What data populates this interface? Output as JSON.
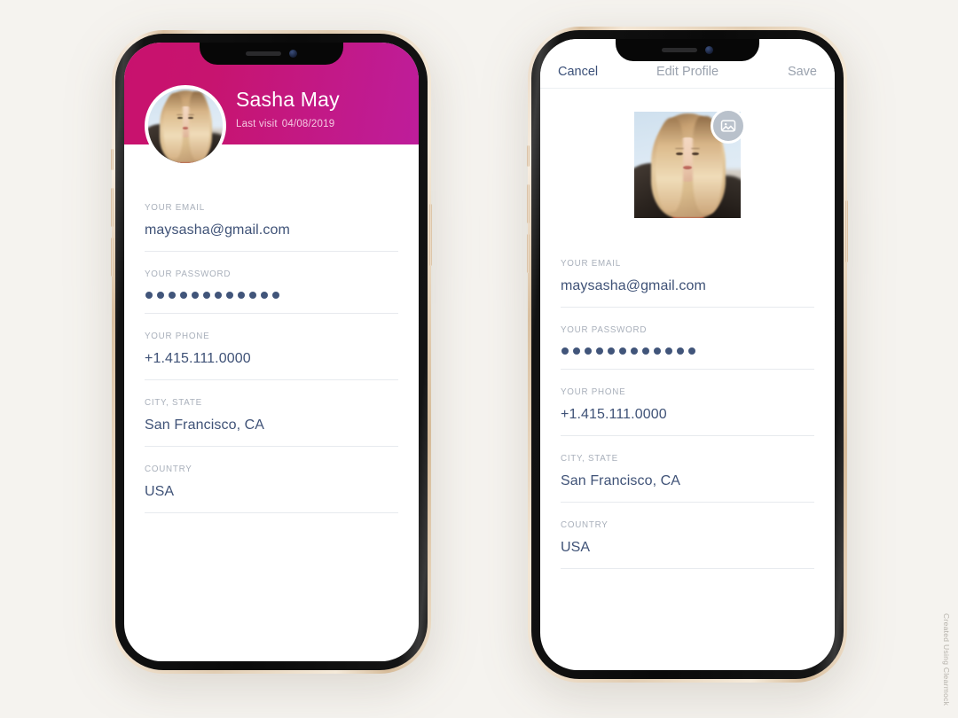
{
  "canvas": {
    "background_color": "#f5f3ef",
    "credit": "Created Using Clearmock"
  },
  "phone_left": {
    "name": "profile-view",
    "header": {
      "gradient_from": "#c8116e",
      "gradient_to": "#be1d9b",
      "profile_name": "Sasha May",
      "last_visit_label": "Last visit",
      "last_visit_date": "04/08/2019",
      "avatar_alt": "Sasha May profile photo"
    },
    "fields": [
      {
        "label": "YOUR EMAIL",
        "value": "maysasha@gmail.com",
        "type": "text"
      },
      {
        "label": "YOUR PASSWORD",
        "value": "••••••••••••",
        "type": "password",
        "dots": 12
      },
      {
        "label": "YOUR PHONE",
        "value": "+1.415.111.0000",
        "type": "text"
      },
      {
        "label": "CITY, STATE",
        "value": "San Francisco, CA",
        "type": "text"
      },
      {
        "label": "COUNTRY",
        "value": "USA",
        "type": "text"
      }
    ]
  },
  "phone_right": {
    "name": "edit-profile-view",
    "navbar": {
      "cancel_label": "Cancel",
      "title": "Edit Profile",
      "save_label": "Save",
      "cancel_color": "#3c5179",
      "title_color": "#9aa2ae",
      "save_color": "#9aa2ae"
    },
    "avatar": {
      "alt": "Sasha May profile photo",
      "badge_icon": "image-picker-icon",
      "badge_color": "#b9c1cb"
    },
    "fields": [
      {
        "label": "YOUR EMAIL",
        "value": "maysasha@gmail.com",
        "type": "text"
      },
      {
        "label": "YOUR PASSWORD",
        "value": "••••••••••••",
        "type": "password",
        "dots": 12
      },
      {
        "label": "YOUR PHONE",
        "value": "+1.415.111.0000",
        "type": "text"
      },
      {
        "label": "CITY, STATE",
        "value": "San Francisco, CA",
        "type": "text"
      },
      {
        "label": "COUNTRY",
        "value": "USA",
        "type": "text"
      }
    ]
  },
  "theme": {
    "value_color": "#3f5277",
    "label_color": "#a9b0bb",
    "divider_color": "#e7eaee",
    "frame_gold": "#e2cdb2",
    "frame_black": "#0a0a0a"
  }
}
